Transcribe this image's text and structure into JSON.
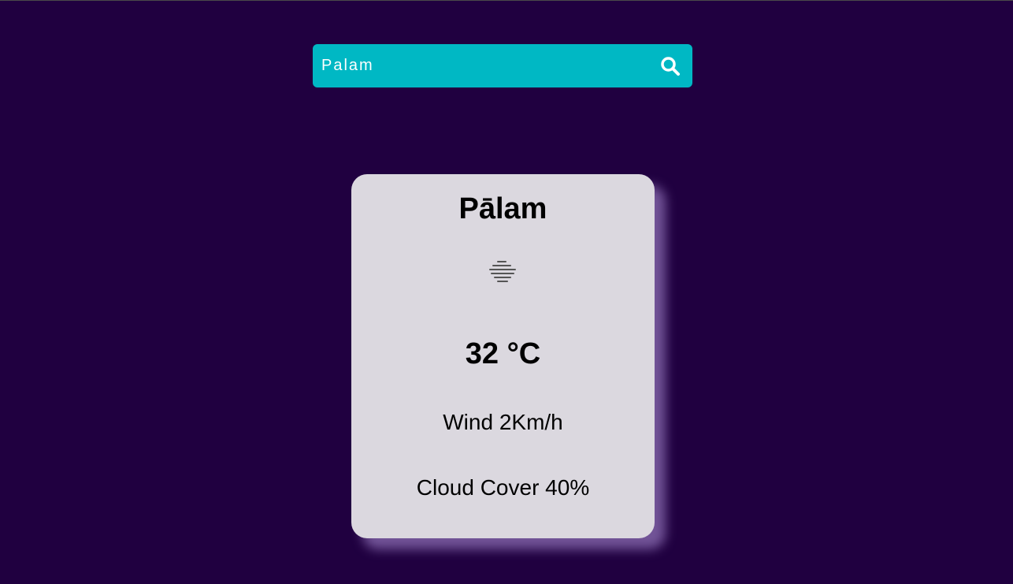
{
  "search": {
    "value": "Palam",
    "button_icon": "search-icon"
  },
  "weather": {
    "city": "Pālam",
    "condition_icon": "mist-icon",
    "temperature": "32 °C",
    "wind": "Wind 2Km/h",
    "cloud_cover": "Cloud Cover 40%"
  },
  "colors": {
    "background": "#200040",
    "search_bar": "#00b8c4",
    "card": "#dbd8df",
    "card_shadow": "#9678be"
  }
}
